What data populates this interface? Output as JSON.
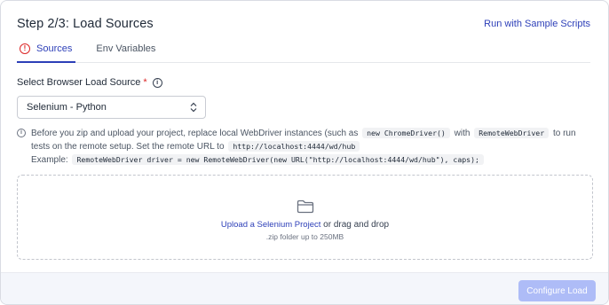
{
  "header": {
    "title": "Step 2/3: Load Sources",
    "sample_link": "Run with Sample Scripts"
  },
  "tabs": [
    {
      "label": "Sources",
      "active": true,
      "icon": "error-circle-icon"
    },
    {
      "label": "Env Variables",
      "active": false
    }
  ],
  "field": {
    "label": "Select Browser Load Source",
    "required_mark": "*",
    "selected_value": "Selenium - Python"
  },
  "hint": {
    "text_1": "Before you zip and upload your project, replace local WebDriver instances (such as",
    "code_1": "new ChromeDriver()",
    "text_2": "with",
    "code_2": "RemoteWebDriver",
    "text_3": "to run tests on the remote setup. Set the remote URL to",
    "code_3": "http://localhost:4444/wd/hub"
  },
  "example": {
    "label": "Example:",
    "code": "RemoteWebDriver driver = new RemoteWebDriver(new URL(\"http://localhost:4444/wd/hub\"), caps);"
  },
  "dropzone": {
    "link_text": "Upload a Selenium Project",
    "rest_text": "or drag and drop",
    "subtext": ".zip folder up to 250MB"
  },
  "footer": {
    "configure_label": "Configure Load"
  },
  "colors": {
    "accent": "#2d3fb8",
    "error": "#dc2626",
    "button_disabled": "#aebcf7"
  }
}
